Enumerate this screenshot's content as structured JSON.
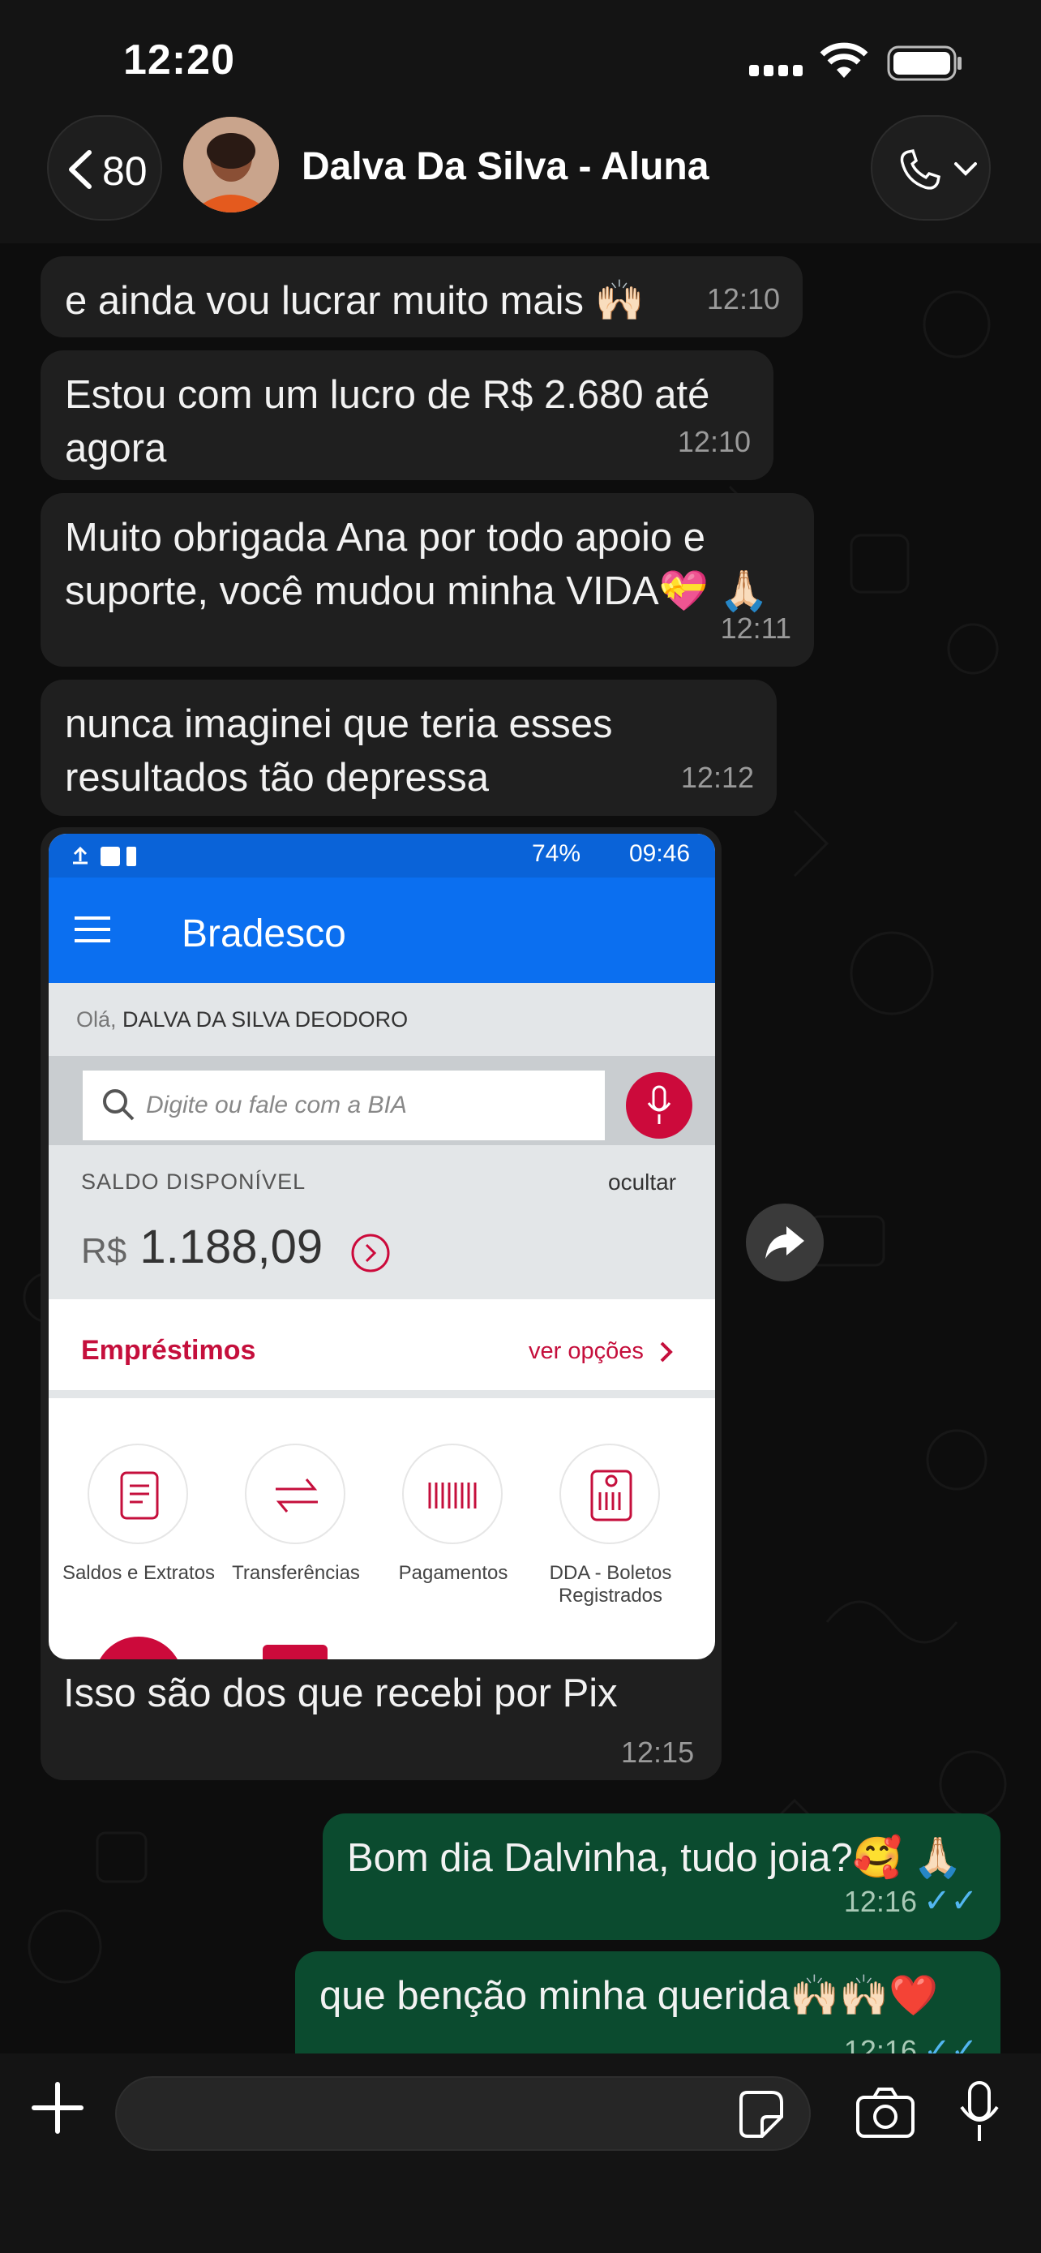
{
  "status_bar": {
    "time": "12:20"
  },
  "header": {
    "back_count": "80",
    "contact_name": "Dalva Da Silva - Aluna"
  },
  "messages": [
    {
      "text": "e ainda vou lucrar muito mais 🙌🏻",
      "time": "12:10"
    },
    {
      "text": "Estou com um lucro de R$ 2.680 até agora",
      "time": "12:10"
    },
    {
      "text": "Muito obrigada Ana por todo apoio e suporte, você mudou minha VIDA💝 🙏🏻",
      "time": "12:11"
    },
    {
      "text": "nunca imaginei que teria esses resultados tão depressa",
      "time": "12:12"
    },
    {
      "text": "Isso são dos que recebi por Pix",
      "time": "12:15"
    },
    {
      "text": "Bom dia Dalvinha, tudo joia?🥰 🙏🏻",
      "time": "12:16"
    },
    {
      "text": "que benção minha querida🙌🏻🙌🏻❤️",
      "time": "12:16"
    }
  ],
  "bank_screenshot": {
    "status_battery": "74%",
    "status_time": "09:46",
    "bank_name": "Bradesco",
    "greeting_prefix": "Olá,",
    "greeting_name": "DALVA DA SILVA DEODORO",
    "search_placeholder": "Digite ou fale com a BIA",
    "balance_label": "SALDO DISPONÍVEL",
    "balance_hide": "ocultar",
    "balance_currency": "R$",
    "balance_value": "1.188,09",
    "loans_label": "Empréstimos",
    "loans_link": "ver opções",
    "services": [
      "Saldos e Extratos",
      "Transferências",
      "Pagamentos",
      "DDA - Boletos Registrados"
    ]
  },
  "colors": {
    "incoming": "#1f1f1f",
    "outgoing": "#0b4b2f",
    "bank_blue": "#0b6ff0",
    "bank_red": "#cc0a3b",
    "read_ticks": "#52b6f0"
  }
}
